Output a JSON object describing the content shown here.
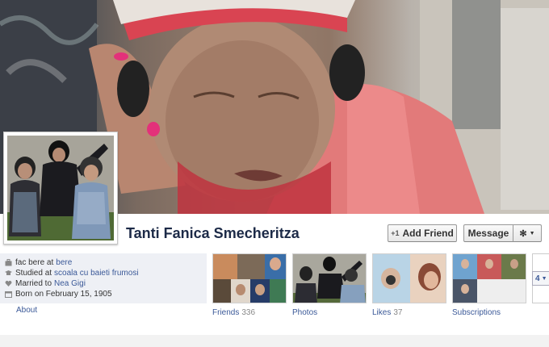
{
  "profile": {
    "name": "Tanti Fanica Smecheritza"
  },
  "actions": {
    "add_friend": "Add Friend",
    "add_friend_icon": "plus-one-icon",
    "message": "Message",
    "settings_icon": "gear-icon"
  },
  "info": {
    "work_prefix": "fac bere at",
    "work_link": "bere",
    "study_prefix": "Studied at",
    "study_link": "scoala cu baieti frumosi",
    "married_prefix": "Married to",
    "married_link": "Nea Gigi",
    "born": "Born on February 15, 1905",
    "about": "About"
  },
  "thumbs": [
    {
      "label": "Friends",
      "count": "336"
    },
    {
      "label": "Photos",
      "count": ""
    },
    {
      "label": "Likes",
      "count": "37"
    },
    {
      "label": "Subscriptions",
      "count": ""
    }
  ],
  "more": {
    "label": "4"
  },
  "colors": {
    "link": "#3b5998",
    "name": "#1c2a47",
    "info_bg": "#eef0f5"
  }
}
